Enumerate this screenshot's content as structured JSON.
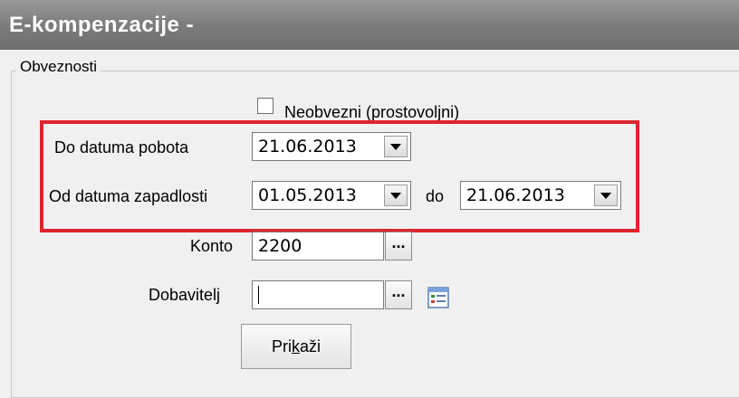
{
  "window": {
    "title": "E-kompenzacije -"
  },
  "group": {
    "legend": "Obveznosti"
  },
  "checkbox": {
    "label": "Neobvezni (prostovoljni)",
    "checked": false
  },
  "fields": {
    "do_datuma_pobota": {
      "label": "Do datuma pobota",
      "value": "21.06.2013"
    },
    "od_datuma_zapadlosti": {
      "label": "Od datuma zapadlosti",
      "value": "01.05.2013"
    },
    "do_label": "do",
    "do_value": "21.06.2013",
    "konto": {
      "label": "Konto",
      "value": "2200"
    },
    "dobavitelj": {
      "label": "Dobavitelj",
      "value": ""
    }
  },
  "buttons": {
    "ellipsis": "...",
    "prikazi_pre": "Pri",
    "prikazi_accel": "k",
    "prikazi_post": "aži"
  },
  "colors": {
    "highlight": "#e0242d",
    "titlebar": "#7f7f7f"
  },
  "icons": {
    "dropdown": "chevron-down-icon",
    "list": "list-icon"
  }
}
